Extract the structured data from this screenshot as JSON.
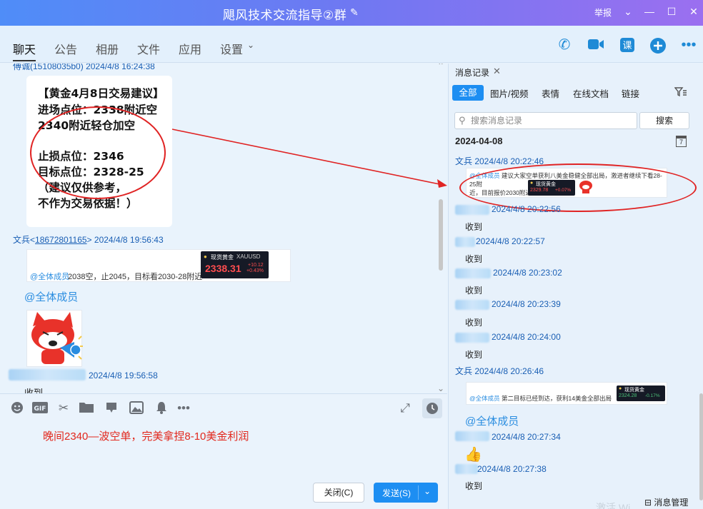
{
  "window": {
    "title": "飓风技术交流指导②群",
    "report_label": "举报"
  },
  "tabs": [
    "聊天",
    "公告",
    "相册",
    "文件",
    "应用",
    "设置"
  ],
  "chat": {
    "msg1": {
      "sender": "傅诚(15108035b0) 2024/4/8 16:24:38",
      "image_lines": [
        "【黄金4月8日交易建议】",
        "进场点位：2338附近空",
        "2340附近轻仓加空",
        "止损点位：2346",
        "目标点位：2328-25",
        "（建议仅供参考，",
        "不作为交易依据！）"
      ]
    },
    "msg2": {
      "sender_name": "文兵<",
      "sender_qq": "18672801165",
      "sender_tail": "> 2024/4/8 19:56:43",
      "mention": "@全体成员",
      "text": "2038空，止2045，目标看2030-28附近",
      "quote_label": "现货黄金",
      "quote_symbol": "XAUUSD",
      "quote_price": "2338.31",
      "quote_change": "+10.12",
      "quote_pct": "+0.43%"
    },
    "msg3_mention": "@全体成员",
    "msg4": {
      "time": "2024/4/8 19:56:58",
      "text": "收到"
    }
  },
  "input": {
    "draft": "晚间2340—波空单，完美拿捏8-10美金利润",
    "close_label": "关闭(C)",
    "send_label": "发送(S)"
  },
  "history": {
    "title": "消息记录",
    "filters": [
      "全部",
      "图片/视频",
      "表情",
      "在线文档",
      "链接"
    ],
    "search_placeholder": "搜索消息记录",
    "search_button": "搜索",
    "date": "2024-04-08",
    "calendar_day": "7",
    "records": [
      {
        "sender": "文兵 2024/4/8 20:22:46"
      },
      {
        "sender": "2024/4/8 20:22:56",
        "body": "收到"
      },
      {
        "sender": "2024/4/8 20:22:57",
        "body": "收到"
      },
      {
        "sender": "2024/4/8 20:23:02",
        "body": "收到"
      },
      {
        "sender": "2024/4/8 20:23:39",
        "body": "收到"
      },
      {
        "sender": "2024/4/8 20:24:00",
        "body": "收到"
      },
      {
        "sender": "文兵 2024/4/8 20:26:46"
      },
      {
        "sender": "2024/4/8 20:27:34"
      },
      {
        "sender": "2024/4/8 20:27:38",
        "body": "收到"
      }
    ],
    "card1": {
      "mention": "@全体成员",
      "text1": "建议大家空单获利八美金稳健全部出局，激进者继续下看28-25附",
      "text2": "近，目前报价2030附近",
      "gold_label": "现货黄金",
      "gold_price": "2329.78",
      "gold_pct": "+0.07%"
    },
    "card2": {
      "mention": "@全体成员",
      "text": "第二目标已经到达，获利14美金全部出局",
      "gold_label": "现货黄金",
      "gold_price": "2324.28",
      "gold_pct": "-0.17%"
    },
    "mention_all": "@全体成员",
    "watermark": "激活 Wi...",
    "manage_label": "消息管理"
  },
  "colors": {
    "accent": "#1d8ef2",
    "annotation": "#e02424",
    "title_gradient_start": "#4f8df8",
    "title_gradient_end": "#9b6ff0"
  }
}
